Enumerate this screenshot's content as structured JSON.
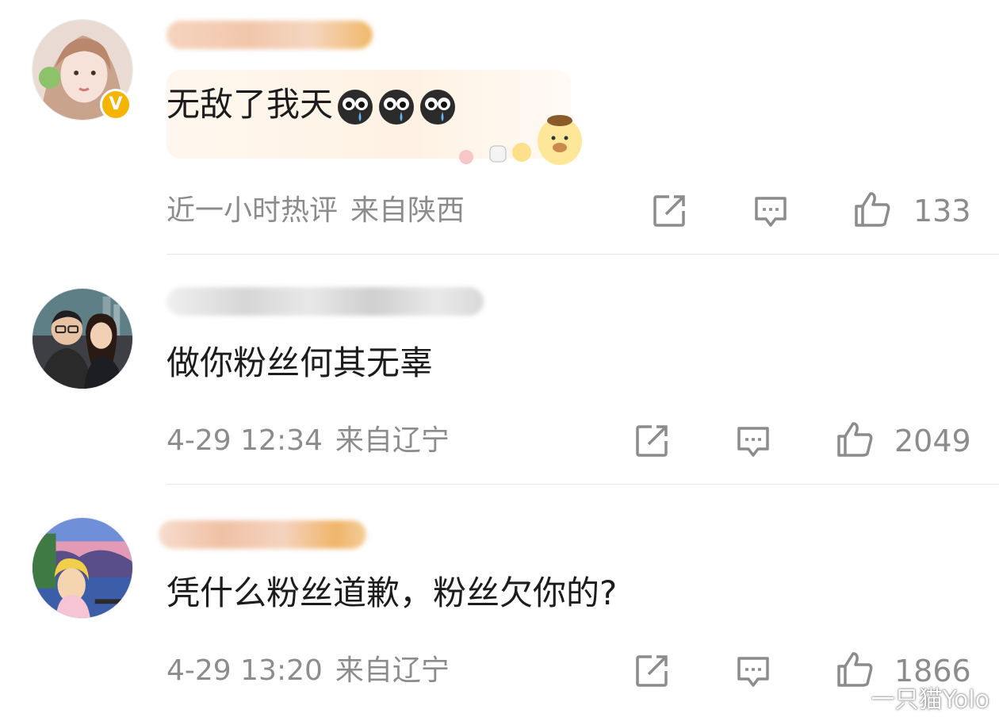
{
  "comments": [
    {
      "text": "无敌了我天",
      "emoji": "crying-face-emoji",
      "time": "近一小时热评",
      "location": "来自陕西",
      "likes": "133",
      "verified": true
    },
    {
      "text": "做你粉丝何其无辜",
      "time": "4-29 12:34",
      "location": "来自辽宁",
      "likes": "2049"
    },
    {
      "text": "凭什么粉丝道歉，粉丝欠你的?",
      "time": "4-29 13:20",
      "location": "来自辽宁",
      "likes": "1866"
    }
  ],
  "icons": {
    "share": "share-icon",
    "reply": "comment-icon",
    "like": "thumbs-up-icon"
  },
  "watermark": {
    "text": "一只猫Yolo"
  },
  "colors": {
    "meta_text": "#8c8c8c",
    "verified_badge": "#f5b400",
    "divider": "#e6e6e6"
  }
}
